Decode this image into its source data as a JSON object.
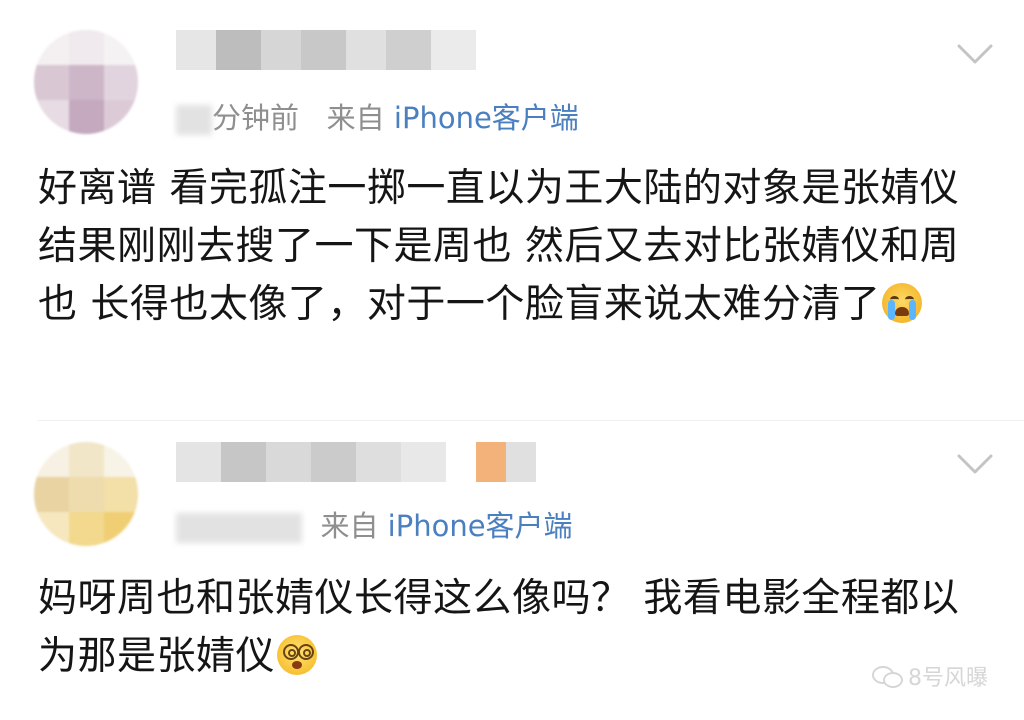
{
  "posts": [
    {
      "time_suffix": "分钟前",
      "source_prefix": "来自",
      "client": "iPhone客户端",
      "text": "好离谱 看完孤注一掷一直以为王大陆的对象是张婧仪 结果刚刚去搜了一下是周也 然后又去对比张婧仪和周也 长得也太像了，对于一个脸盲来说太难分清了",
      "emoji": "loudly-crying-face"
    },
    {
      "time_suffix": "",
      "source_prefix": "来自",
      "client": "iPhone客户端",
      "text": "妈呀周也和张婧仪长得这么像吗？ 我看电影全程都以为那是张婧仪",
      "emoji": "dizzy-face"
    }
  ],
  "watermark": {
    "text": "8号风曝",
    "icon": "wechat-icon"
  }
}
